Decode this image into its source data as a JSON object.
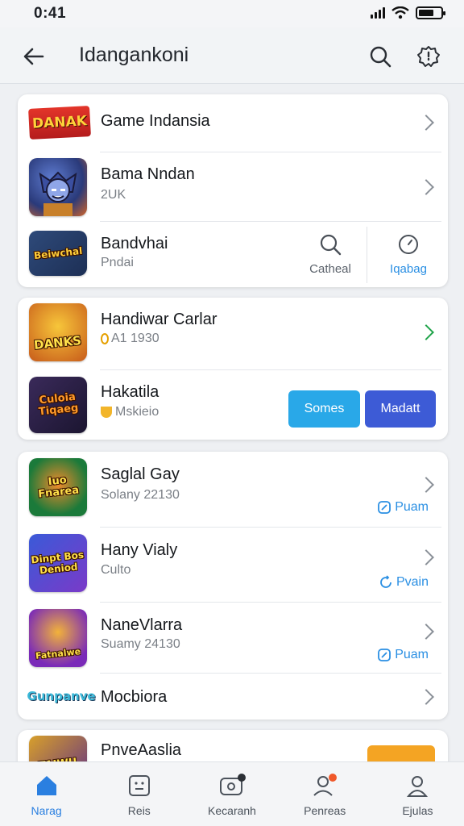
{
  "status_bar": {
    "time": "0:41"
  },
  "header": {
    "title": "Idangankoni"
  },
  "card1": {
    "rows": [
      {
        "name": "Game Indansia",
        "logo_text": "DANAK"
      },
      {
        "name": "Bama Nndan",
        "sub": "2UK"
      },
      {
        "name": "Bandvhai",
        "sub": "Pndai",
        "logo_text": "Beiwchal",
        "action_search": "Catheal",
        "action_timer": "Iqabag"
      }
    ]
  },
  "card2": {
    "rows": [
      {
        "name": "Handiwar Carlar",
        "sub": "A1 1930",
        "logo_text": "DANKS"
      },
      {
        "name": "Hakatila",
        "sub": "Mskieio",
        "logo_text": "Culoia Tiqaeg",
        "btn_primary": "Somes",
        "btn_secondary": "Madatt"
      }
    ]
  },
  "card3": {
    "rows": [
      {
        "name": "Saglal Gay",
        "sub": "Solany 22130",
        "logo_text": "Iuo Fnarea",
        "link": "Puam"
      },
      {
        "name": "Hany Vialy",
        "sub": "Culto",
        "logo_text": "Dinpt Bos Deniod",
        "link": "Pvain"
      },
      {
        "name": "NaneVlarra",
        "sub": "Suamy 24130",
        "logo_text": "Fatnalwe",
        "link": "Puam"
      },
      {
        "name": "Mocbiora",
        "logo_text": "Gunpanve"
      }
    ]
  },
  "card4": {
    "name": "PnveAaslia",
    "logo_text": "TAIWU"
  },
  "nav": {
    "items": [
      {
        "label": "Narag"
      },
      {
        "label": "Reis"
      },
      {
        "label": "Kecaranh"
      },
      {
        "label": "Penreas"
      },
      {
        "label": "Ejulas"
      }
    ]
  },
  "colors": {
    "accent": "#2a7fe0",
    "button_primary": "#29a8e8",
    "button_secondary": "#3d5bd6",
    "green_chevron": "#1fa34a",
    "orange": "#f4a423"
  }
}
